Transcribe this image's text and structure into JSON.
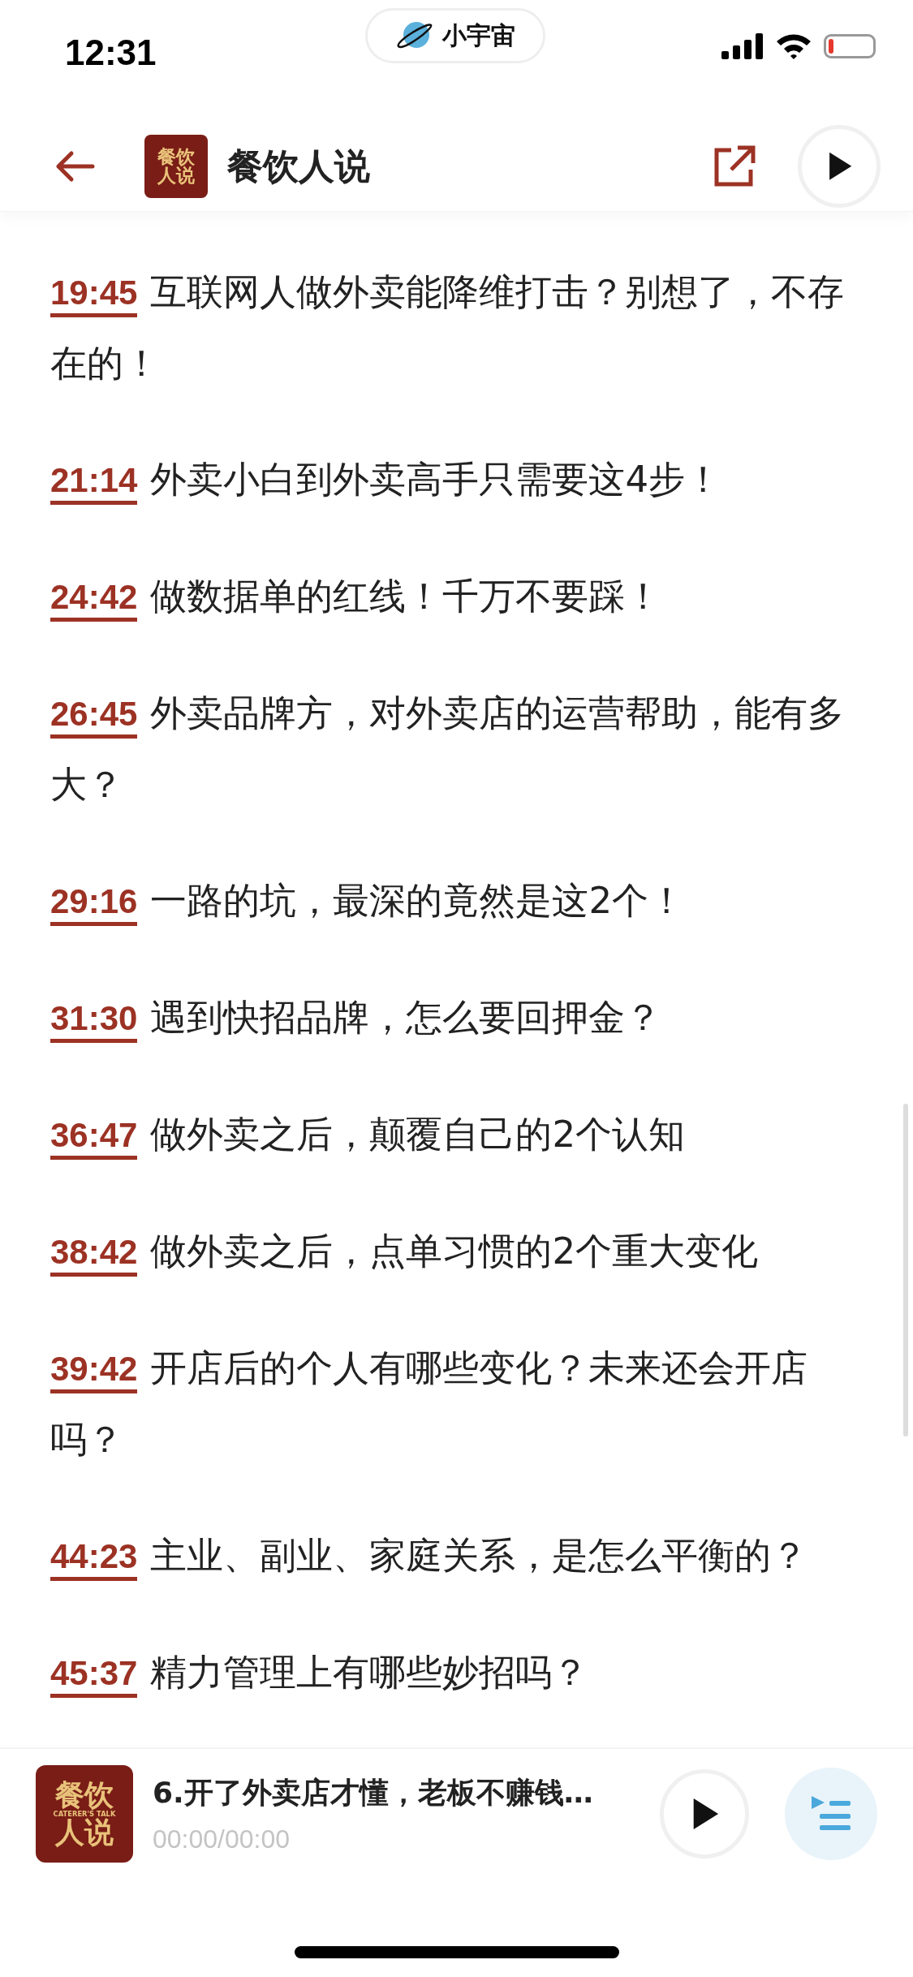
{
  "status_bar": {
    "time": "12:31",
    "app_pill": "小宇宙"
  },
  "header": {
    "title": "餐饮人说",
    "logo": {
      "top": "餐饮",
      "bottom": "人说"
    }
  },
  "chapters": [
    {
      "time": "19:45",
      "title": "互联网人做外卖能降维打击？别想了，不存在的！"
    },
    {
      "time": "21:14",
      "title": "外卖小白到外卖高手只需要这4步！"
    },
    {
      "time": "24:42",
      "title": "做数据单的红线！千万不要踩！"
    },
    {
      "time": "26:45",
      "title": "外卖品牌方，对外卖店的运营帮助，能有多大？"
    },
    {
      "time": "29:16",
      "title": "一路的坑，最深的竟然是这2个！"
    },
    {
      "time": "31:30",
      "title": "遇到快招品牌，怎么要回押金？"
    },
    {
      "time": "36:47",
      "title": "做外卖之后，颠覆自己的2个认知"
    },
    {
      "time": "38:42",
      "title": "做外卖之后，点单习惯的2个重大变化"
    },
    {
      "time": "39:42",
      "title": "开店后的个人有哪些变化？未来还会开店吗？"
    },
    {
      "time": "44:23",
      "title": "主业、副业、家庭关系，是怎么平衡的？"
    },
    {
      "time": "45:37",
      "title": "精力管理上有哪些妙招吗？"
    }
  ],
  "player": {
    "logo": {
      "top": "餐饮",
      "middle": "CATERER'S TALK",
      "bottom": "人说"
    },
    "title": "6.开了外卖店才懂，老板不赚钱…",
    "progress": "00:00/00:00"
  }
}
